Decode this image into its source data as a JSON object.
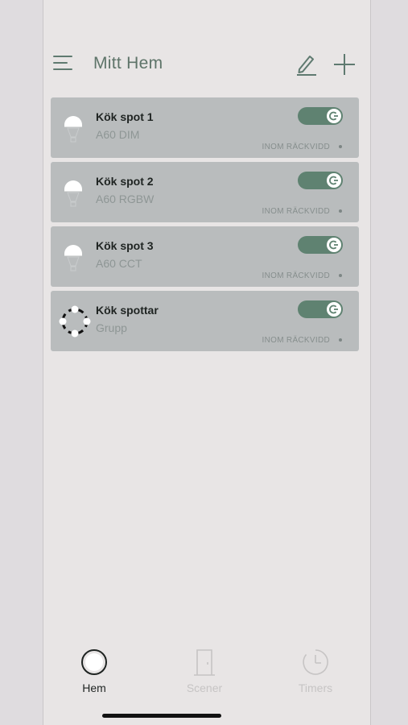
{
  "header": {
    "title": "Mitt Hem",
    "menu_icon": "hamburger-menu-icon",
    "edit_icon": "pencil-icon",
    "add_icon": "plus-icon"
  },
  "devices": [
    {
      "name": "Kök spot 1",
      "type": "A60 DIM",
      "status": "INOM RÄCKVIDD",
      "on": true,
      "icon": "light-bulb-icon"
    },
    {
      "name": "Kök spot 2",
      "type": "A60 RGBW",
      "status": "INOM RÄCKVIDD",
      "on": true,
      "icon": "light-bulb-icon"
    },
    {
      "name": "Kök spot 3",
      "type": "A60 CCT",
      "status": "INOM RÄCKVIDD",
      "on": true,
      "icon": "light-bulb-icon"
    },
    {
      "name": "Kök spottar",
      "type": "Grupp",
      "status": "INOM RÄCKVIDD",
      "on": true,
      "icon": "group-circle-icon"
    }
  ],
  "tabs": [
    {
      "label": "Hem",
      "icon": "home-circle-icon",
      "active": true
    },
    {
      "label": "Scener",
      "icon": "door-icon",
      "active": false
    },
    {
      "label": "Timers",
      "icon": "clock-icon",
      "active": false
    }
  ],
  "colors": {
    "accent": "#5f8271",
    "card_bg": "#b9bcbd",
    "screen_bg": "#e8e5e5",
    "title": "#5e7469"
  }
}
